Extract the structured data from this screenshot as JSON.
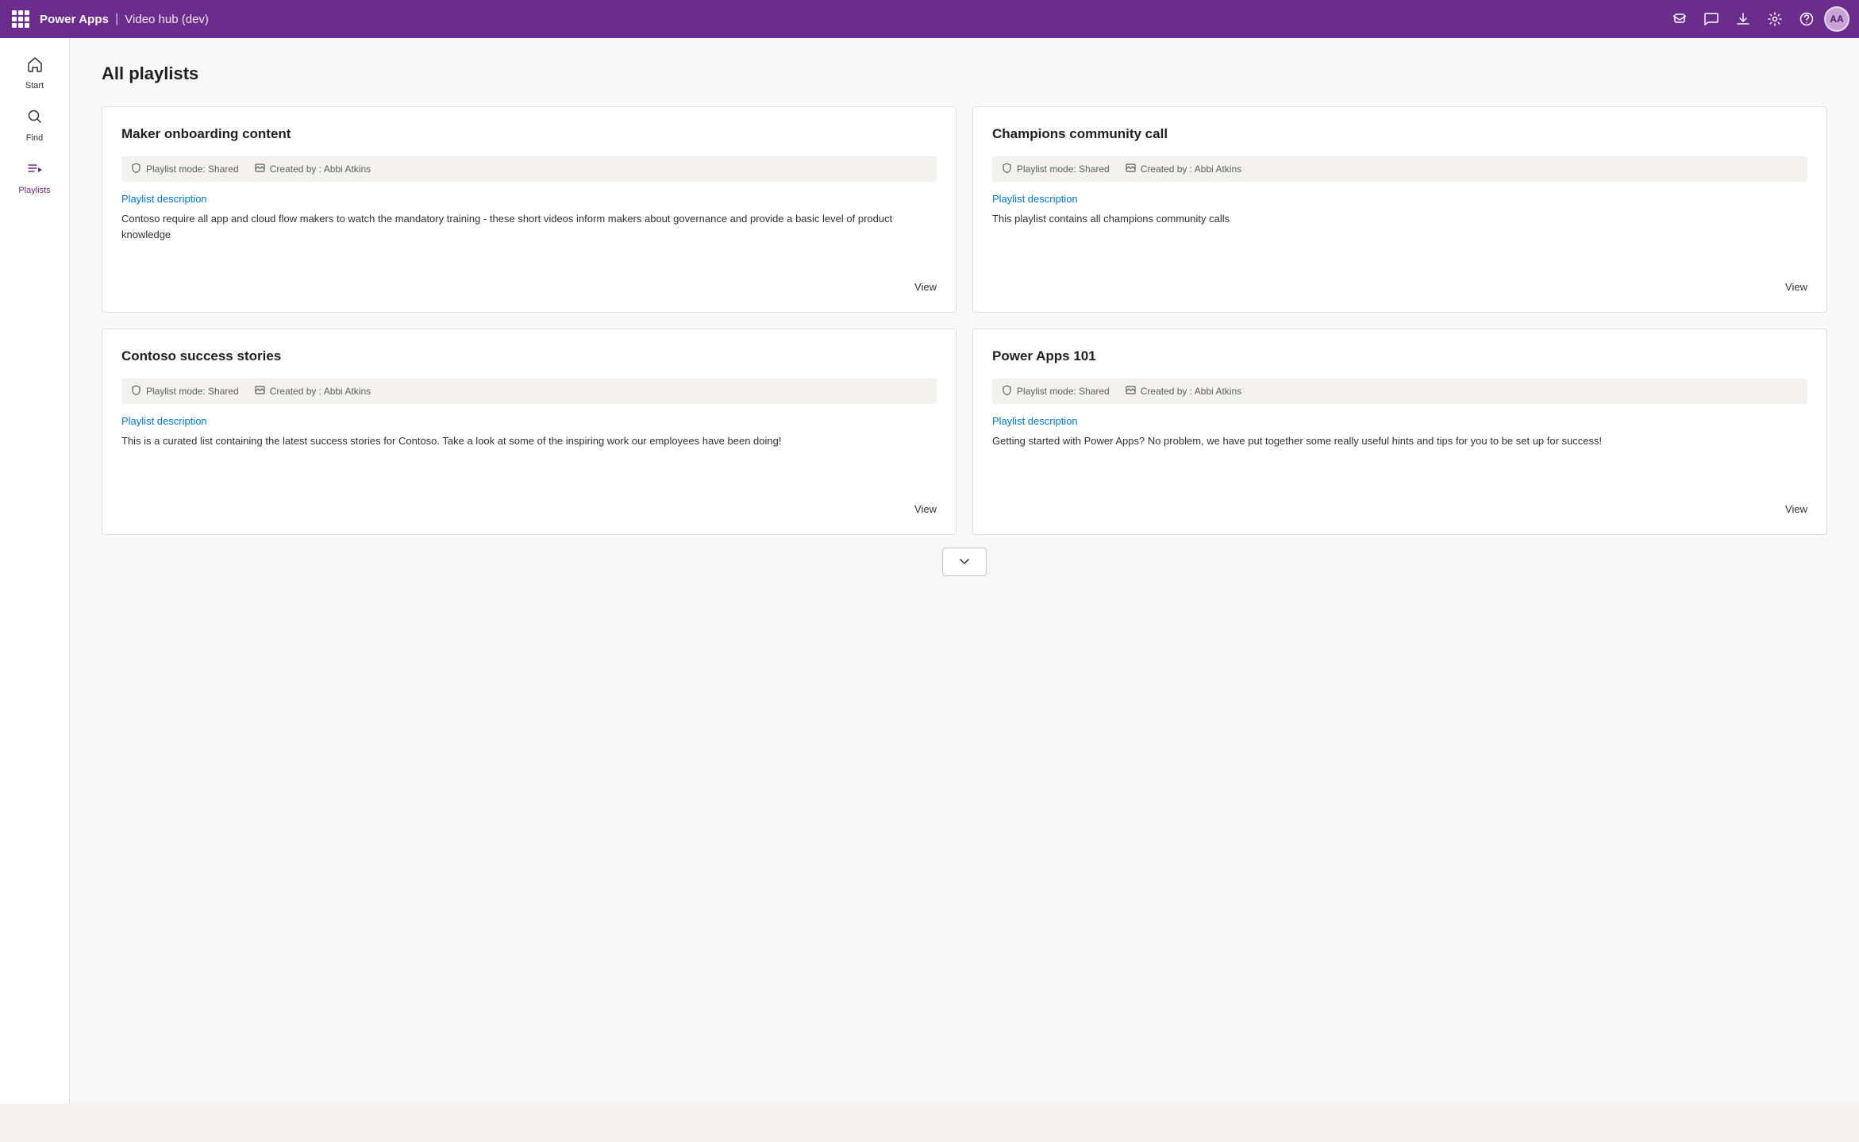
{
  "app": {
    "title": "Power Apps",
    "separator": "|",
    "subtitle": "Video hub (dev)",
    "avatar_initials": "AA"
  },
  "topbar": {
    "icons": {
      "notifications_label": "Notifications",
      "chat_label": "Chat",
      "download_label": "Download",
      "settings_label": "Settings",
      "help_label": "Help"
    }
  },
  "sidebar": {
    "items": [
      {
        "id": "start",
        "label": "Start",
        "icon": "home"
      },
      {
        "id": "find",
        "label": "Find",
        "icon": "search"
      },
      {
        "id": "playlists",
        "label": "Playlists",
        "icon": "playlists",
        "active": true
      }
    ]
  },
  "main": {
    "page_title": "All playlists",
    "playlists": [
      {
        "id": "maker-onboarding",
        "title": "Maker onboarding content",
        "playlist_mode": "Playlist mode: Shared",
        "created_by": "Created by : Abbi Atkins",
        "desc_label": "Playlist description",
        "description": "Contoso require all app and cloud flow makers to watch the mandatory training - these short videos inform makers about governance and provide a basic level of product knowledge",
        "view_label": "View"
      },
      {
        "id": "champions-community",
        "title": "Champions community call",
        "playlist_mode": "Playlist mode: Shared",
        "created_by": "Created by : Abbi Atkins",
        "desc_label": "Playlist description",
        "description": "This playlist contains all champions community calls",
        "view_label": "View"
      },
      {
        "id": "contoso-success",
        "title": "Contoso success stories",
        "playlist_mode": "Playlist mode: Shared",
        "created_by": "Created by : Abbi Atkins",
        "desc_label": "Playlist description",
        "description": "This is a curated list containing the latest success stories for Contoso.  Take a look at some of the inspiring work our employees have been doing!",
        "view_label": "View"
      },
      {
        "id": "power-apps-101",
        "title": "Power Apps 101",
        "playlist_mode": "Playlist mode: Shared",
        "created_by": "Created by : Abbi Atkins",
        "desc_label": "Playlist description",
        "description": "Getting started with Power Apps?  No problem, we have put together some really useful hints and tips for you to be set up for success!",
        "view_label": "View"
      }
    ],
    "scroll_more_label": "∨"
  },
  "colors": {
    "accent_purple": "#6b2d8b",
    "link_blue": "#0078d4"
  }
}
